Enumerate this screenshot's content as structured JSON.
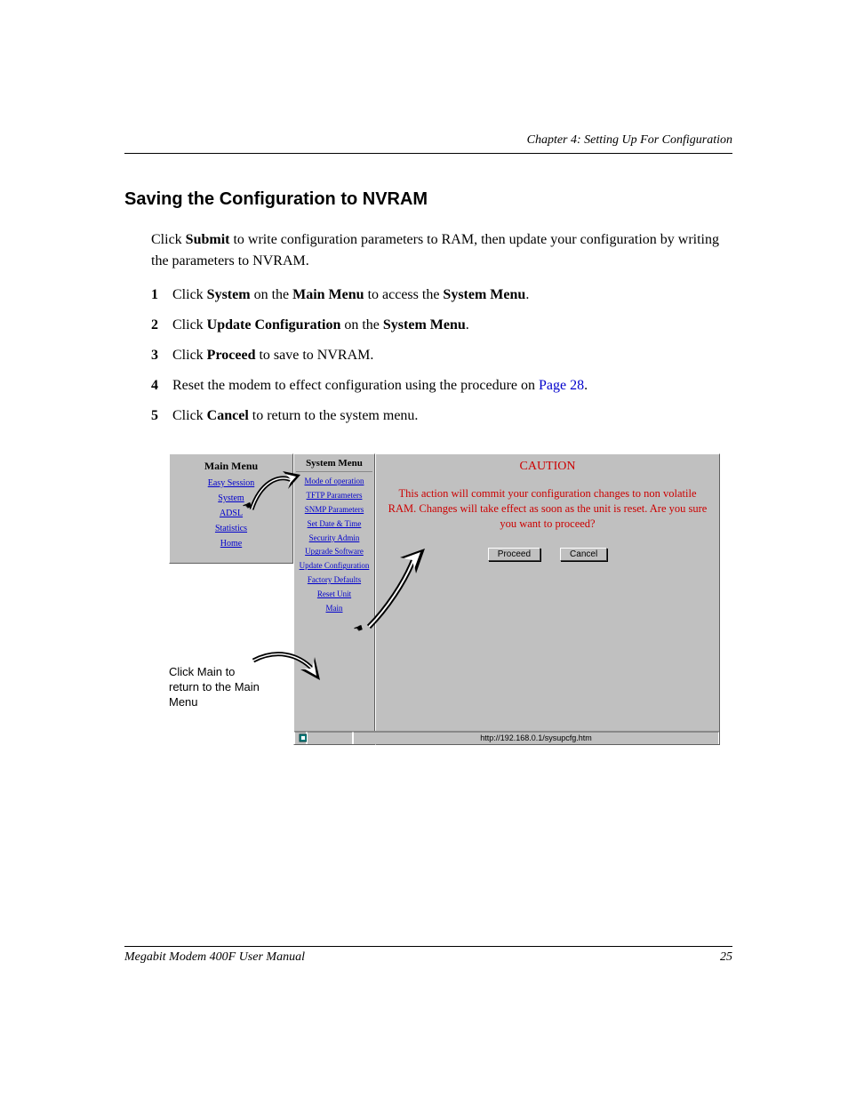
{
  "chapter_header": "Chapter 4:  Setting Up For Configuration",
  "section_title": "Saving the Configuration to NVRAM",
  "intro": {
    "pre": "Click ",
    "bold1": "Submit",
    "post": " to write configuration parameters to RAM, then update your configuration by writing the parameters to NVRAM."
  },
  "steps": [
    {
      "num": "1",
      "parts": [
        "Click ",
        "System",
        " on the ",
        "Main Menu",
        " to access the ",
        "System Menu",
        "."
      ]
    },
    {
      "num": "2",
      "parts": [
        "Click ",
        "Update Configuration",
        " on the ",
        "System Menu",
        "."
      ]
    },
    {
      "num": "3",
      "parts": [
        "Click ",
        "Proceed",
        " to save to NVRAM."
      ]
    },
    {
      "num": "4",
      "plain": "Reset the modem to effect configuration using the procedure on ",
      "link": "Page 28",
      "tail": "."
    },
    {
      "num": "5",
      "parts": [
        "Click ",
        "Cancel",
        " to return to the system menu."
      ]
    }
  ],
  "main_menu": {
    "title": "Main Menu",
    "items": [
      "Easy Session",
      "System",
      "ADSL",
      "Statistics",
      "Home"
    ]
  },
  "system_menu": {
    "title": "System Menu",
    "items": [
      "Mode of operation",
      "TFTP Parameters",
      "SNMP Parameters",
      "Set Date & Time",
      "Security Admin",
      "Upgrade Software",
      "Update Configuration",
      "Factory Defaults",
      "Reset Unit",
      "Main"
    ]
  },
  "caution": {
    "title": "CAUTION",
    "text": "This action will commit your configuration changes to non volatile RAM.  Changes will take effect as soon as the unit is reset.  Are you sure you want to proceed?",
    "proceed": "Proceed",
    "cancel": "Cancel"
  },
  "status_url": "http://192.168.0.1/sysupcfg.htm",
  "annotation": "Click Main to return to the Main Menu",
  "footer": {
    "left": "Megabit Modem 400F User Manual",
    "right": "25"
  }
}
